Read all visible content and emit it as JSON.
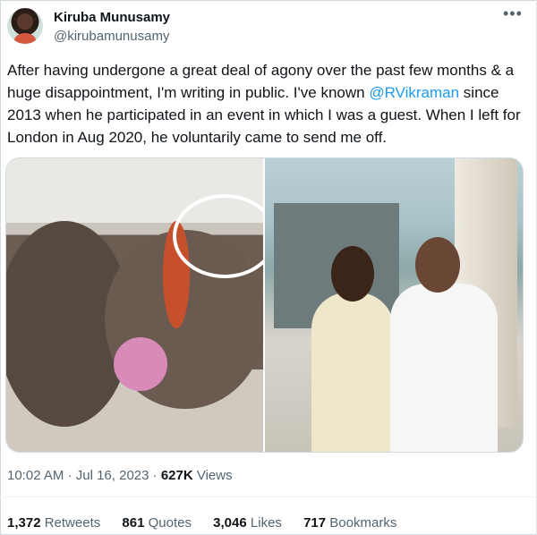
{
  "author": {
    "name": "Kiruba Munusamy",
    "handle": "@kirubamunusamy"
  },
  "more_icon": "more-horizontal-icon",
  "tweet": {
    "text_before": "After having undergone a great deal of agony over the past few months & a huge disappointment, I'm writing in public. I've known ",
    "mention": "@RVikraman",
    "text_after": " since 2013 when he participated in an event in which I was a guest. When I left for London in Aug 2020, he voluntarily came to send me off."
  },
  "meta": {
    "time": "10:02 AM",
    "date": "Jul 16, 2023",
    "separator": "·",
    "views_count": "627K",
    "views_label": "Views"
  },
  "stats": [
    {
      "count": "1,372",
      "label": "Retweets"
    },
    {
      "count": "861",
      "label": "Quotes"
    },
    {
      "count": "3,046",
      "label": "Likes"
    },
    {
      "count": "717",
      "label": "Bookmarks"
    }
  ],
  "colors": {
    "link": "#1d9bf0",
    "muted": "#536471",
    "text": "#0f1419"
  }
}
